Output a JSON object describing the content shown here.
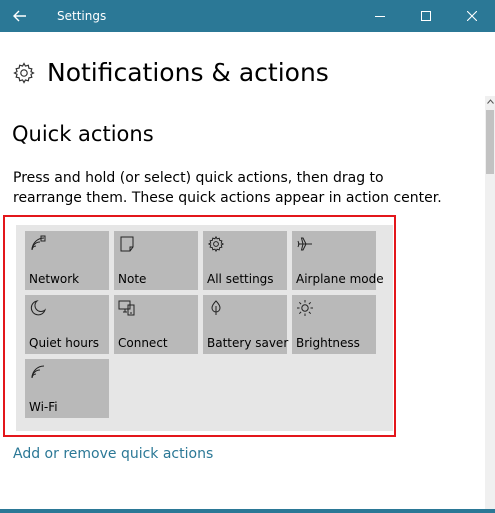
{
  "window": {
    "title": "Settings",
    "accent_color": "#2b7896",
    "back_icon": "back-arrow-icon",
    "minimize_icon": "minimize-icon",
    "maximize_icon": "maximize-icon",
    "close_icon": "close-icon"
  },
  "page": {
    "title": "Notifications & actions",
    "icon": "gear-icon"
  },
  "quick_actions": {
    "heading": "Quick actions",
    "description": "Press and hold (or select) quick actions, then drag to rearrange them. These quick actions appear in action center.",
    "highlight_color": "#e3161b",
    "tiles": [
      {
        "label": "Network",
        "icon": "network-icon"
      },
      {
        "label": "Note",
        "icon": "note-icon"
      },
      {
        "label": "All settings",
        "icon": "gear-icon"
      },
      {
        "label": "Airplane mode",
        "icon": "airplane-icon"
      },
      {
        "label": "Quiet hours",
        "icon": "moon-icon"
      },
      {
        "label": "Connect",
        "icon": "connect-icon"
      },
      {
        "label": "Battery saver",
        "icon": "battery-saver-icon"
      },
      {
        "label": "Brightness",
        "icon": "brightness-icon"
      },
      {
        "label": "Wi-Fi",
        "icon": "wifi-icon"
      }
    ],
    "link_label": "Add or remove quick actions"
  }
}
